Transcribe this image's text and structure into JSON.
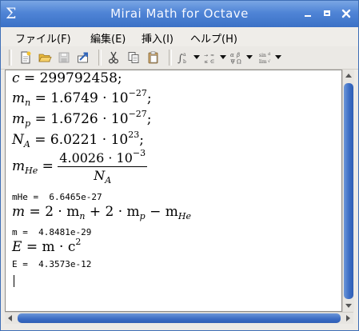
{
  "window": {
    "title": "Mirai Math for Octave",
    "app_icon": "Σ"
  },
  "menubar": [
    {
      "label": "ファイル(F)"
    },
    {
      "label": "編集(E)"
    },
    {
      "label": "挿入(I)"
    },
    {
      "label": "ヘルプ(H)"
    }
  ],
  "toolbar": {
    "icons": [
      "new-document-icon",
      "open-folder-icon",
      "save-icon",
      "export-icon",
      "cut-icon",
      "copy-icon",
      "paste-icon"
    ],
    "dropdowns": [
      "integral-menu-icon",
      "relation-menu-icon",
      "greek-menu-icon",
      "function-menu-icon"
    ]
  },
  "document": {
    "c_lhs": "c",
    "c_val": "299792458;",
    "mn_base": "m",
    "mn_sub": "n",
    "mn_val": "1.6749 · 10",
    "mn_exp": "−27",
    "mp_base": "m",
    "mp_sub": "p",
    "mp_val": "1.6726 · 10",
    "mp_exp": "−27",
    "na_base": "N",
    "na_sub": "A",
    "na_val": "6.0221 · 10",
    "na_exp": "23",
    "mhe_base": "m",
    "mhe_sub": "He",
    "mhe_num": "4.0026 · 10",
    "mhe_num_exp": "−3",
    "mhe_den_base": "N",
    "mhe_den_sub": "A",
    "out_mhe": "mHe =  6.6465e-27",
    "m_lhs": "m",
    "m_rhs_a": "2 · m",
    "m_rhs_a_sub": "n",
    "m_rhs_b": " + 2 · m",
    "m_rhs_b_sub": "p",
    "m_rhs_c": " − m",
    "m_rhs_c_sub": "He",
    "out_m": "m =  4.8481e-29",
    "e_lhs": "E",
    "e_rhs": "m · c",
    "e_exp": "2",
    "out_e": "E =  4.3573e-12"
  }
}
